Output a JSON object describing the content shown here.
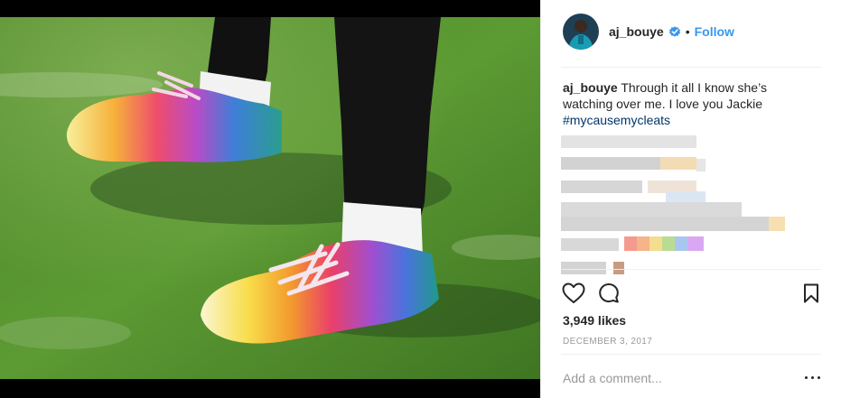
{
  "post": {
    "username": "aj_bouye",
    "follow_label": "Follow",
    "separator": "•",
    "caption_user": "aj_bouye",
    "caption_text": " Through it all I know she’s watching over me. I love you Jackie ",
    "hashtag": "#mycausemycleats",
    "likes": "3,949 likes",
    "date": "DECEMBER 3, 2017",
    "comment_placeholder": "Add a comment..."
  },
  "colors": {
    "link_blue": "#3897f0",
    "hashtag_navy": "#003569",
    "muted_gray": "#999999",
    "text": "#262626"
  },
  "icons": {
    "verified": "verified-badge-icon",
    "like": "heart-icon",
    "comment": "comment-bubble-icon",
    "save": "bookmark-icon",
    "options": "more-options-icon"
  }
}
